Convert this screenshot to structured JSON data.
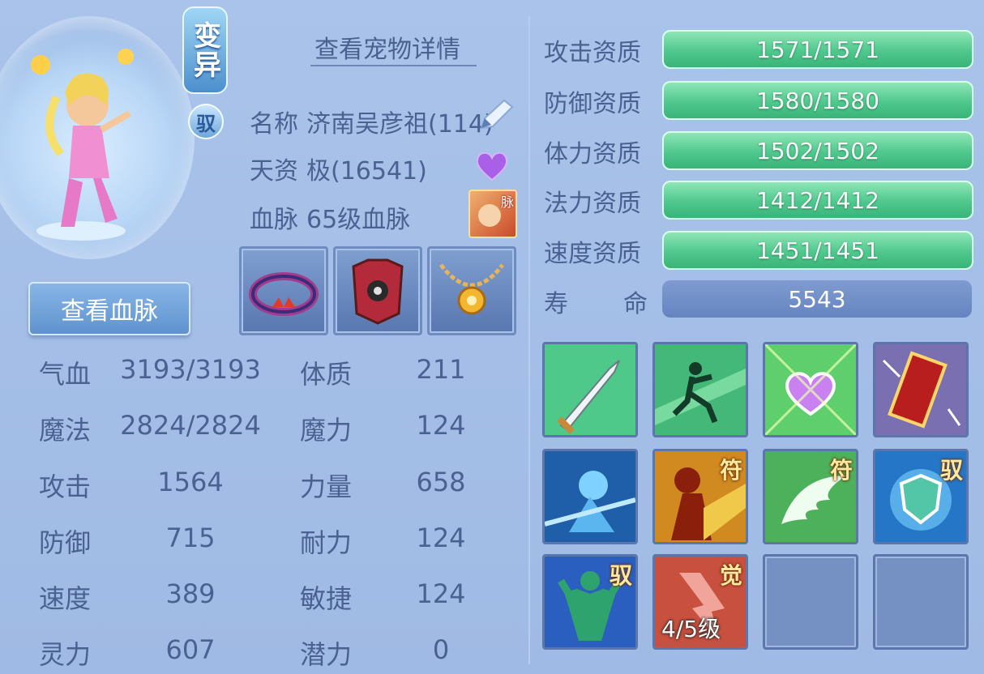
{
  "pet": {
    "variant_badge": "变异",
    "drive_badge": "驭",
    "view_bloodline_button": "查看血脉"
  },
  "header": {
    "title": "查看宠物详情"
  },
  "info": {
    "name_label": "名称",
    "name_value": "济南吴彦祖(114)",
    "talent_label": "天资",
    "talent_value": "极(16541)",
    "blood_label": "血脉",
    "blood_value": "65级血脉",
    "blood_icon_text": "脉"
  },
  "equipment": [
    {
      "icon": "crown-collar-icon"
    },
    {
      "icon": "armor-icon"
    },
    {
      "icon": "necklace-icon"
    }
  ],
  "stats": [
    {
      "label": "气血",
      "value": "3193/3193",
      "label2": "体质",
      "value2": "211"
    },
    {
      "label": "魔法",
      "value": "2824/2824",
      "label2": "魔力",
      "value2": "124"
    },
    {
      "label": "攻击",
      "value": "1564",
      "label2": "力量",
      "value2": "658"
    },
    {
      "label": "防御",
      "value": "715",
      "label2": "耐力",
      "value2": "124"
    },
    {
      "label": "速度",
      "value": "389",
      "label2": "敏捷",
      "value2": "124"
    },
    {
      "label": "灵力",
      "value": "607",
      "label2": "潜力",
      "value2": "0"
    }
  ],
  "aptitudes": [
    {
      "label": "攻击资质",
      "value": "1571/1571",
      "fill": 1.0
    },
    {
      "label": "防御资质",
      "value": "1580/1580",
      "fill": 1.0
    },
    {
      "label": "体力资质",
      "value": "1502/1502",
      "fill": 1.0
    },
    {
      "label": "法力资质",
      "value": "1412/1412",
      "fill": 1.0
    },
    {
      "label": "速度资质",
      "value": "1451/1451",
      "fill": 1.0
    }
  ],
  "life": {
    "label_a": "寿",
    "label_b": "命",
    "value": "5543"
  },
  "skills": [
    {
      "icon": "sword-skill-icon",
      "tag": "",
      "level": ""
    },
    {
      "icon": "dash-skill-icon",
      "tag": "",
      "level": ""
    },
    {
      "icon": "heart-skill-icon",
      "tag": "",
      "level": ""
    },
    {
      "icon": "talisman-skill-icon",
      "tag": "",
      "level": ""
    },
    {
      "icon": "spirit-skill-icon",
      "tag": "",
      "level": ""
    },
    {
      "icon": "berserk-skill-icon",
      "tag": "符",
      "level": ""
    },
    {
      "icon": "wing-skill-icon",
      "tag": "符",
      "level": ""
    },
    {
      "icon": "shield-skill-icon",
      "tag": "驭",
      "level": ""
    },
    {
      "icon": "muscle-skill-icon",
      "tag": "驭",
      "level": ""
    },
    {
      "icon": "awaken-skill-icon",
      "tag": "觉",
      "level": "4/5级"
    },
    {
      "icon": "empty-slot",
      "tag": "",
      "level": ""
    },
    {
      "icon": "empty-slot",
      "tag": "",
      "level": ""
    }
  ],
  "colors": {
    "bg": "#a9c3ea",
    "text": "#4a6291",
    "bar_green": "#4fc88d",
    "bar_life": "#6584c0"
  }
}
